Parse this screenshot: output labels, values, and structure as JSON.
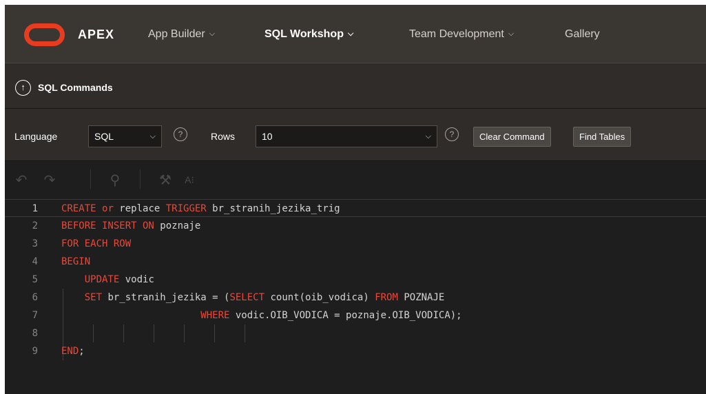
{
  "header": {
    "brand": "APEX",
    "nav": [
      {
        "label": "App Builder",
        "chevron": "⌵"
      },
      {
        "label": "SQL Workshop",
        "chevron": "⌵"
      },
      {
        "label": "Team Development",
        "chevron": "⌵"
      },
      {
        "label": "Gallery"
      }
    ],
    "logo_color": "#e83c20"
  },
  "breadcrumb": {
    "up_icon": "↑",
    "title": "SQL Commands"
  },
  "controls": {
    "language_label": "Language",
    "language_value": "SQL",
    "rows_label": "Rows",
    "rows_value": "10",
    "help_icon": "?",
    "select_arrow": "⌵",
    "clear_button": "Clear Command",
    "find_button": "Find Tables"
  },
  "toolbar": {
    "undo_icon": "↶",
    "redo_icon": "↷",
    "search_icon": "⚲",
    "wrench_icon": "⚒",
    "format_icon": "A⁝"
  },
  "editor": {
    "line_numbers": [
      "1",
      "2",
      "3",
      "4",
      "5",
      "6",
      "7",
      "8",
      "9"
    ],
    "lines": [
      [
        {
          "t": "CREATE",
          "kw": true
        },
        {
          "t": " "
        },
        {
          "t": "or",
          "kw": true
        },
        {
          "t": " replace "
        },
        {
          "t": "TRIGGER",
          "kw": true
        },
        {
          "t": " br_stranih_jezika_trig"
        }
      ],
      [
        {
          "t": "BEFORE INSERT ON",
          "kw": true
        },
        {
          "t": " poznaje"
        }
      ],
      [
        {
          "t": "FOR EACH ROW",
          "kw": true
        }
      ],
      [
        {
          "t": "BEGIN",
          "kw": true
        }
      ],
      [
        {
          "t": "    "
        },
        {
          "t": "UPDATE",
          "kw": true
        },
        {
          "t": " vodic"
        }
      ],
      [
        {
          "t": "    "
        },
        {
          "t": "SET",
          "kw": true
        },
        {
          "t": " br_stranih_jezika = ("
        },
        {
          "t": "SELECT",
          "kw": true
        },
        {
          "t": " count(oib_vodica) "
        },
        {
          "t": "FROM",
          "kw": true
        },
        {
          "t": " POZNAJE"
        }
      ],
      [
        {
          "t": "                        "
        },
        {
          "t": "WHERE",
          "kw": true
        },
        {
          "t": " vodic.OIB_VODICA = poznaje.OIB_VODICA);"
        }
      ],
      [
        {
          "t": ""
        }
      ],
      [
        {
          "t": "END",
          "kw": true
        },
        {
          "t": ";"
        }
      ]
    ]
  }
}
